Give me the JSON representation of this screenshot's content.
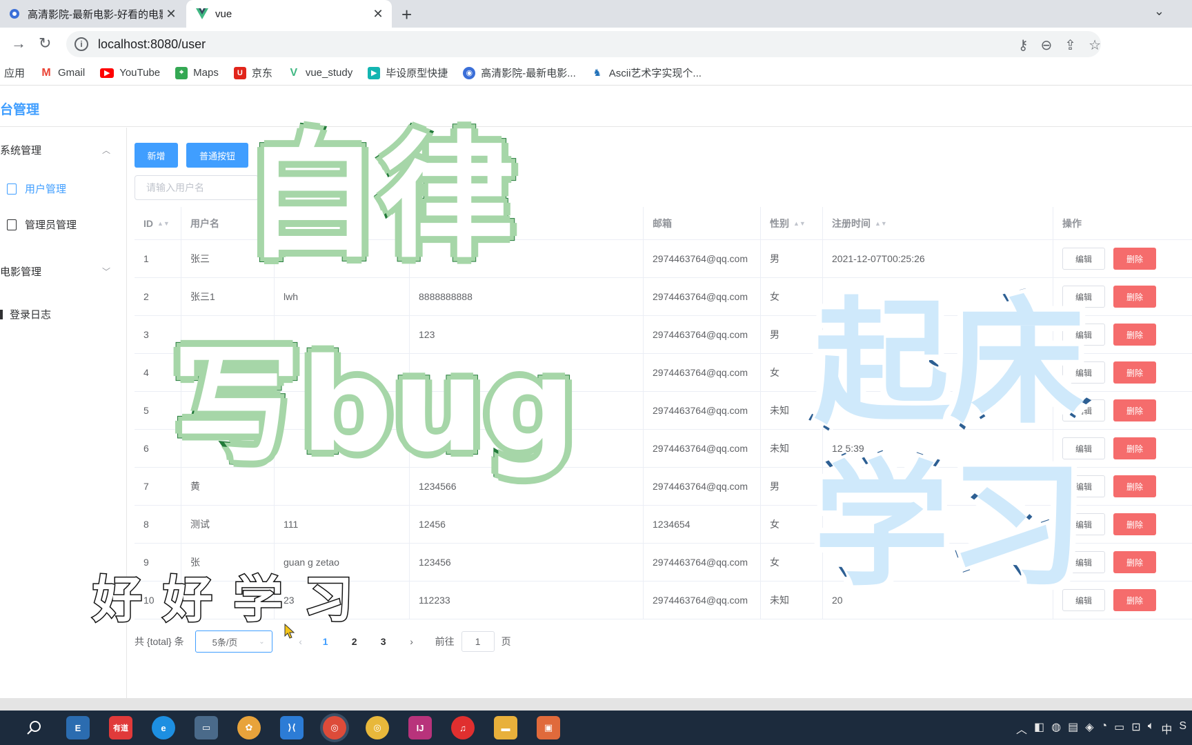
{
  "browser": {
    "tabs": [
      {
        "title": "高清影院-最新电影-好看的电影-"
      },
      {
        "title": "vue"
      }
    ],
    "address": "localhost:8080/user",
    "bookmarks": [
      "应用",
      "Gmail",
      "YouTube",
      "Maps",
      "京东",
      "vue_study",
      "毕设原型快捷",
      "高清影院-最新电影...",
      "Ascii艺术字实现个..."
    ]
  },
  "app": {
    "title": "台管理"
  },
  "sidebar": {
    "system_menu": "系统管理",
    "user_mgmt": "用户管理",
    "admin_mgmt": "管理员管理",
    "movie_menu": "电影管理",
    "login_log": "登录日志"
  },
  "toolbar": {
    "add_label": "新增",
    "normal_label": "普通按钮",
    "search_placeholder": "请输入用户名"
  },
  "table": {
    "headers": {
      "id": "ID",
      "username": "用户名",
      "email": "邮箱",
      "gender": "性别",
      "reg_time": "注册时间",
      "actions": "操作"
    },
    "edit_label": "编辑",
    "delete_label": "删除",
    "rows": [
      {
        "id": "1",
        "username": "张三",
        "nickname": "",
        "phone": "",
        "email": "2974463764@qq.com",
        "gender": "男",
        "time": "2021-12-07T00:25:26"
      },
      {
        "id": "2",
        "username": "张三1",
        "nickname": "lwh",
        "phone": "8888888888",
        "email": "2974463764@qq.com",
        "gender": "女",
        "time": ""
      },
      {
        "id": "3",
        "username": "",
        "nickname": "",
        "phone": "123",
        "email": "2974463764@qq.com",
        "gender": "男",
        "time": ""
      },
      {
        "id": "4",
        "username": "",
        "nickname": "",
        "phone": "",
        "email": "2974463764@qq.com",
        "gender": "女",
        "time": ""
      },
      {
        "id": "5",
        "username": "",
        "nickname": "",
        "phone": "",
        "email": "2974463764@qq.com",
        "gender": "未知",
        "time": ""
      },
      {
        "id": "6",
        "username": "",
        "nickname": "",
        "phone": "",
        "email": "2974463764@qq.com",
        "gender": "未知",
        "time": "12 5:39"
      },
      {
        "id": "7",
        "username": "黄",
        "nickname": "",
        "phone": "1234566",
        "email": "2974463764@qq.com",
        "gender": "男",
        "time": ""
      },
      {
        "id": "8",
        "username": "测试",
        "nickname": "111",
        "phone": "12456",
        "email": "1234654",
        "gender": "女",
        "time": ""
      },
      {
        "id": "9",
        "username": "张",
        "nickname": "guan g zetao",
        "phone": "123456",
        "email": "2974463764@qq.com",
        "gender": "女",
        "time": ""
      },
      {
        "id": "10",
        "username": "",
        "nickname": "23",
        "phone": "112233",
        "email": "2974463764@qq.com",
        "gender": "未知",
        "time": "20"
      }
    ]
  },
  "pagination": {
    "total_label": "共 {total} 条",
    "page_size": "5条/页",
    "pages": [
      "1",
      "2",
      "3"
    ],
    "goto_label": "前往",
    "goto_value": "1",
    "page_suffix": "页"
  },
  "overlay": {
    "line1": "自律",
    "line2": "写bug",
    "line3": "起床",
    "line4": "学习",
    "small": "好好学习"
  },
  "taskbar": {
    "tray_ime": "中"
  }
}
